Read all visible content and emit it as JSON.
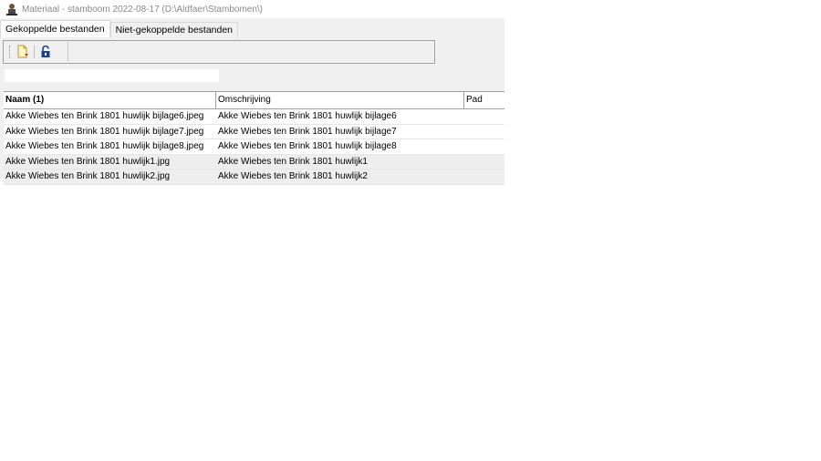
{
  "window": {
    "title": "Materiaal - stamboom 2022-08-17 (D:\\Aldfaer\\Stambomen\\)"
  },
  "tabs": [
    {
      "label": "Gekoppelde bestanden",
      "active": true
    },
    {
      "label": "Niet-gekoppelde bestanden",
      "active": false
    }
  ],
  "toolbar": {
    "icons": [
      "new-document-icon",
      "unlock-icon"
    ]
  },
  "filter": {
    "value": "",
    "placeholder": ""
  },
  "table": {
    "columns": [
      "Naam (1)",
      "Omschrijving",
      "Pad"
    ],
    "rows": [
      {
        "naam": "Akke Wiebes ten Brink 1801 huwlijk bijlage6.jpeg",
        "omschrijving": "Akke Wiebes ten Brink 1801 huwlijk bijlage6",
        "pad": ""
      },
      {
        "naam": "Akke Wiebes ten Brink 1801 huwlijk bijlage7.jpeg",
        "omschrijving": "Akke Wiebes ten Brink 1801 huwlijk bijlage7",
        "pad": ""
      },
      {
        "naam": "Akke Wiebes ten Brink 1801 huwlijk bijlage8.jpeg",
        "omschrijving": "Akke Wiebes ten Brink 1801 huwlijk bijlage8",
        "pad": ""
      },
      {
        "naam": "Akke Wiebes ten Brink 1801 huwlijk1.jpg",
        "omschrijving": "Akke Wiebes ten Brink 1801 huwlijk1",
        "pad": ""
      },
      {
        "naam": "Akke Wiebes ten Brink 1801 huwlijk2.jpg",
        "omschrijving": "Akke Wiebes ten Brink 1801 huwlijk2",
        "pad": ""
      }
    ]
  },
  "colors": {
    "header_border": "#a0a0a0",
    "selected_row": "#eeeeee"
  }
}
